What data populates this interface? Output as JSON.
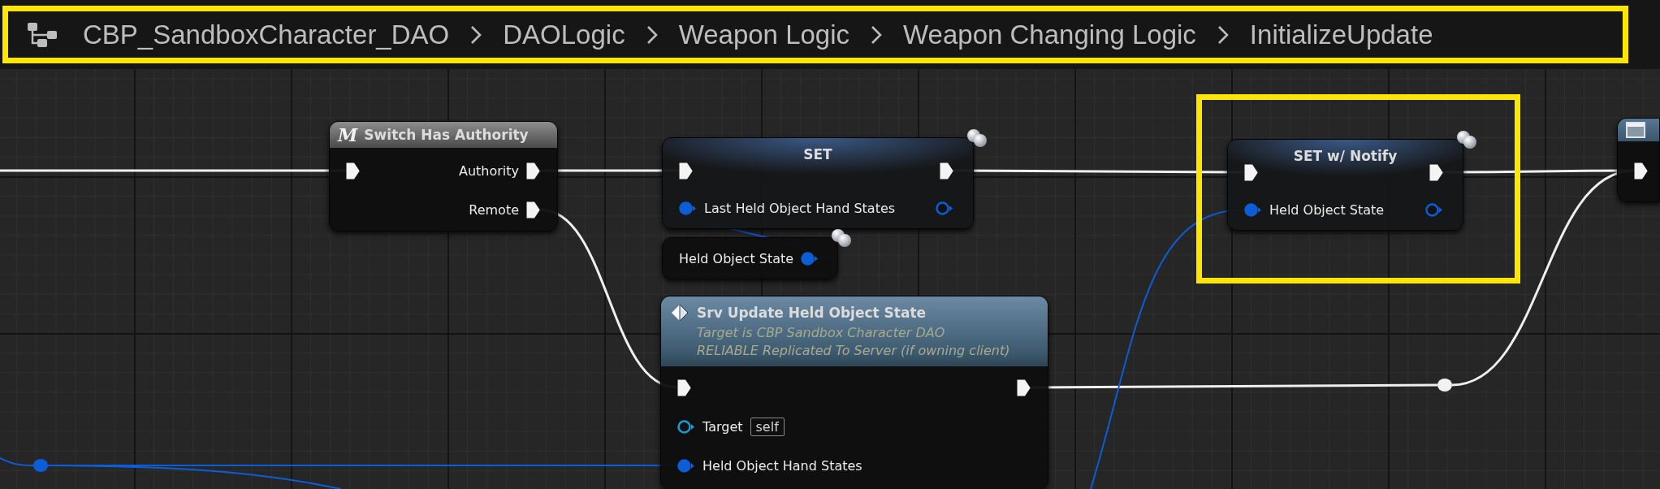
{
  "breadcrumb": {
    "highlighted": true,
    "items": [
      "CBP_SandboxCharacter_DAO",
      "DAOLogic",
      "Weapon Logic",
      "Weapon Changing Logic",
      "InitializeUpdate"
    ]
  },
  "nodes": [
    {
      "kind": "switch",
      "symbol": "M",
      "title": "Switch Has Authority",
      "replicated": false,
      "highlighted": false,
      "rows": [
        {
          "in": {
            "kind": "exec",
            "connected": true
          },
          "out": {
            "kind": "exec",
            "label": "Authority",
            "connected": true
          }
        },
        {
          "out": {
            "kind": "exec",
            "label": "Remote",
            "connected": true
          }
        }
      ]
    },
    {
      "kind": "set",
      "title": "SET",
      "replicated": true,
      "highlighted": false,
      "rows": [
        {
          "in": {
            "kind": "exec",
            "connected": true
          },
          "out": {
            "kind": "exec",
            "connected": true
          }
        },
        {
          "in": {
            "kind": "data",
            "label": "Last Held Object Hand States",
            "connected": true
          },
          "out": {
            "kind": "data",
            "connected": false
          }
        }
      ]
    },
    {
      "kind": "getter",
      "replicated": true,
      "highlighted": false,
      "rows": [
        {
          "out": {
            "kind": "data",
            "label": "Held Object State",
            "connected": true
          }
        }
      ]
    },
    {
      "kind": "function",
      "title": "Srv Update Held Object State",
      "subtitle": [
        "Target is CBP Sandbox Character DAO",
        "RELIABLE Replicated To Server (if owning client)"
      ],
      "replicated": false,
      "highlighted": false,
      "rows": [
        {
          "in": {
            "kind": "exec",
            "connected": true
          },
          "out": {
            "kind": "exec",
            "connected": true
          }
        },
        {
          "in": {
            "kind": "object",
            "label": "Target",
            "default": "self",
            "connected": false
          }
        },
        {
          "in": {
            "kind": "data",
            "label": "Held Object Hand States",
            "connected": true
          }
        }
      ]
    },
    {
      "kind": "set",
      "title": "SET w/ Notify",
      "replicated": true,
      "highlighted": true,
      "rows": [
        {
          "in": {
            "kind": "exec",
            "connected": true
          },
          "out": {
            "kind": "exec",
            "connected": true
          }
        },
        {
          "in": {
            "kind": "data",
            "label": "Held Object State",
            "connected": true
          },
          "out": {
            "kind": "data",
            "connected": false
          }
        }
      ]
    },
    {
      "kind": "widget",
      "replicated": false,
      "highlighted": false,
      "rows": [
        {
          "in": {
            "kind": "exec",
            "connected": true
          }
        }
      ]
    },
    {
      "kind": "exec_knot"
    },
    {
      "kind": "data_knot"
    }
  ]
}
